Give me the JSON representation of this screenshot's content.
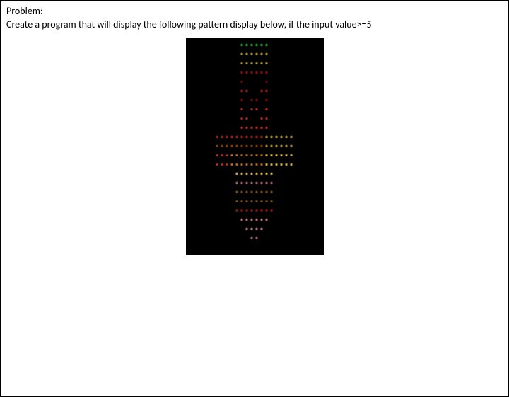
{
  "problem_label": "Problem:",
  "problem_text": "Create a program that will display the following pattern display below, if the input value>=5",
  "pattern_rows": [
    {
      "segments": [
        {
          "text": "******",
          "cls": "green"
        }
      ]
    },
    {
      "segments": [
        {
          "text": "******",
          "cls": "yellow"
        }
      ]
    },
    {
      "segments": [
        {
          "text": "******",
          "cls": "olive"
        }
      ]
    },
    {
      "segments": [
        {
          "text": "******",
          "cls": "darkred"
        }
      ]
    },
    {
      "segments": [
        {
          "text": "*    *",
          "cls": "maroon"
        }
      ]
    },
    {
      "segments": [
        {
          "text": "**  **",
          "cls": "red"
        }
      ]
    },
    {
      "segments": [
        {
          "text": "* ** *",
          "cls": "darkred"
        }
      ]
    },
    {
      "segments": [
        {
          "text": "* ** *",
          "cls": "red"
        }
      ]
    },
    {
      "segments": [
        {
          "text": "**  **",
          "cls": "red"
        }
      ]
    },
    {
      "segments": [
        {
          "text": "******",
          "cls": "red"
        }
      ]
    },
    {
      "segments": [
        {
          "text": "**********",
          "cls": "red"
        },
        {
          "text": "******",
          "cls": "yellow"
        }
      ]
    },
    {
      "segments": [
        {
          "text": "**********",
          "cls": "dkorange"
        },
        {
          "text": "******",
          "cls": "yellow"
        }
      ]
    },
    {
      "segments": [
        {
          "text": "***",
          "cls": "red"
        },
        {
          "text": "*******",
          "cls": "orange"
        },
        {
          "text": "******",
          "cls": "yellow"
        }
      ]
    },
    {
      "segments": [
        {
          "text": "***",
          "cls": "red"
        },
        {
          "text": "*******",
          "cls": "orange"
        },
        {
          "text": "******",
          "cls": "yellow"
        }
      ]
    },
    {
      "segments": [
        {
          "text": "********",
          "cls": "yellow"
        }
      ]
    },
    {
      "segments": [
        {
          "text": "********",
          "cls": "pink"
        }
      ]
    },
    {
      "segments": [
        {
          "text": "********",
          "cls": "lbrown"
        }
      ]
    },
    {
      "segments": [
        {
          "text": "********",
          "cls": "brown"
        }
      ]
    },
    {
      "segments": [
        {
          "text": "********",
          "cls": "darkred"
        }
      ]
    },
    {
      "segments": [
        {
          "text": "******",
          "cls": "pink"
        }
      ]
    },
    {
      "segments": [
        {
          "text": "****",
          "cls": "lpink"
        }
      ]
    },
    {
      "segments": [
        {
          "text": "**",
          "cls": "pink"
        }
      ]
    }
  ]
}
